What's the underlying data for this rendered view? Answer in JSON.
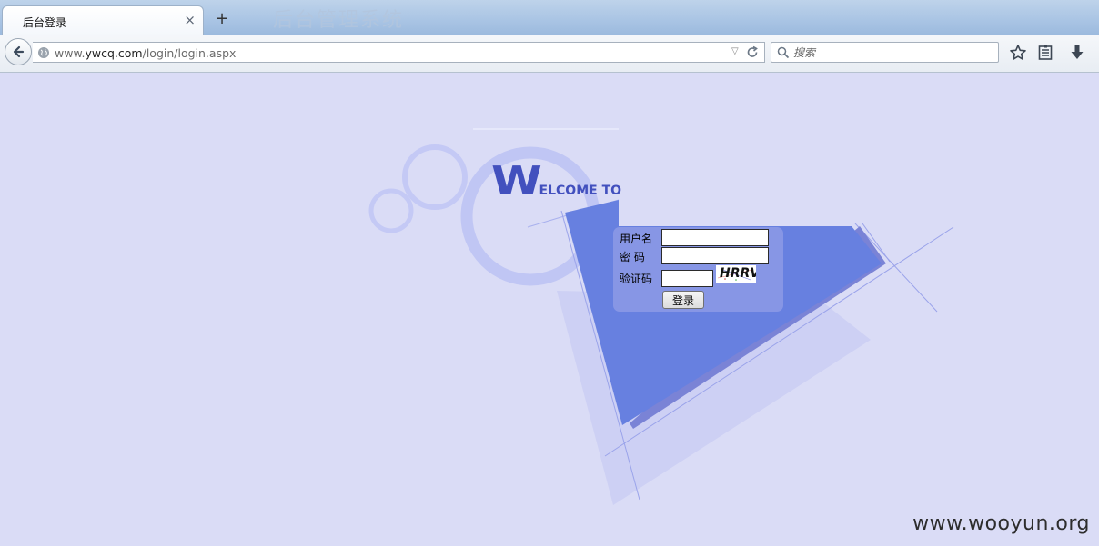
{
  "browser": {
    "tab_title": "后台登录",
    "tab_close": "×",
    "new_tab": "+",
    "url_prefix": "www.",
    "url_domain": "ywcq.com",
    "url_path": "/login/login.aspx",
    "search_placeholder": "搜索",
    "ghost_title": "后台管理系统"
  },
  "page": {
    "welcome_big": "W",
    "welcome_rest": "ELCOME TO",
    "username_label": "用户名",
    "password_label": "密 码",
    "captcha_label": "验证码",
    "captcha_value": "HRRV",
    "login_button": "登录",
    "username_value": "",
    "password_value": "",
    "captcha_input_value": ""
  },
  "watermark": "www.wooyun.org",
  "colors": {
    "page_background": "#dadcf6",
    "triangle": "#6780e0",
    "welcome_text": "#4250be",
    "panel": "#8796e5"
  }
}
